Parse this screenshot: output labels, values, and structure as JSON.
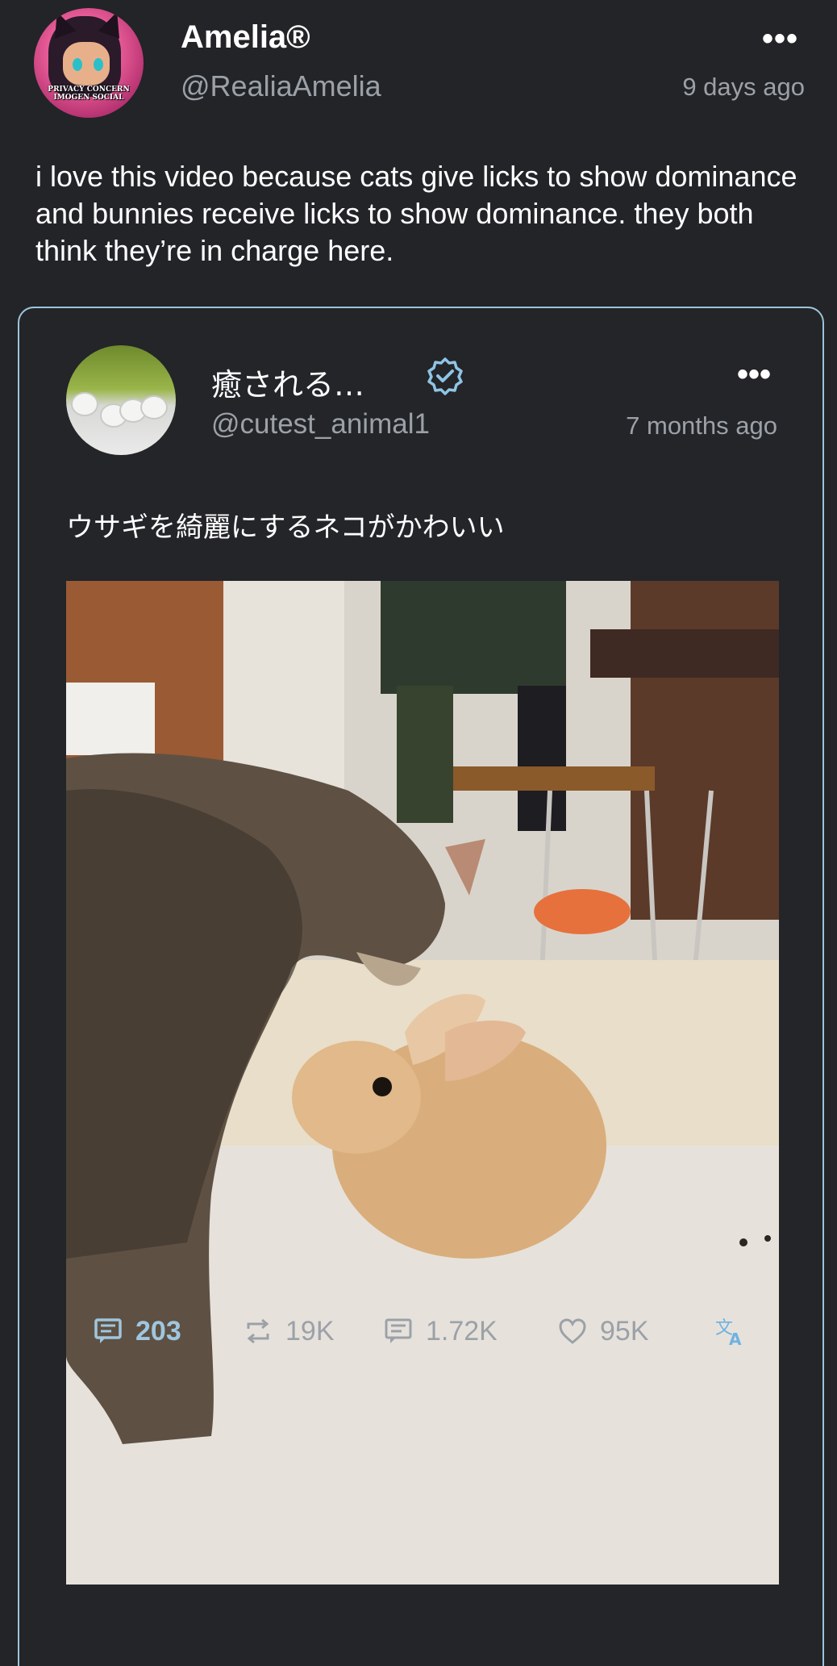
{
  "outer_post": {
    "display_name": "Amelia®",
    "handle": "@RealiaAmelia",
    "time": "9 days ago",
    "more": "•••",
    "text": "i love this video because cats give licks to show dominance and bunnies receive licks to show dominance. they both think they’re in charge here.",
    "avatar_caption": "PRIVACY CONCERN IMOGEN SOCIAL"
  },
  "quoted_post": {
    "display_name": "癒される…",
    "handle": "@cutest_animal1",
    "time": "7 months ago",
    "more": "•••",
    "text": "ウサギを綺麗にするネコがかわいい",
    "verified": true
  },
  "actions": {
    "quotes": "203",
    "reposts": "19K",
    "comments": "1.72K",
    "likes": "95K"
  },
  "colors": {
    "background": "#222428",
    "accent": "#9fc6e0",
    "muted": "#9ca1a8",
    "card_border": "#9fc3d9"
  },
  "icons": [
    "more-icon",
    "verified-icon",
    "quote-icon",
    "repost-icon",
    "comment-icon",
    "like-icon",
    "translate-icon"
  ]
}
